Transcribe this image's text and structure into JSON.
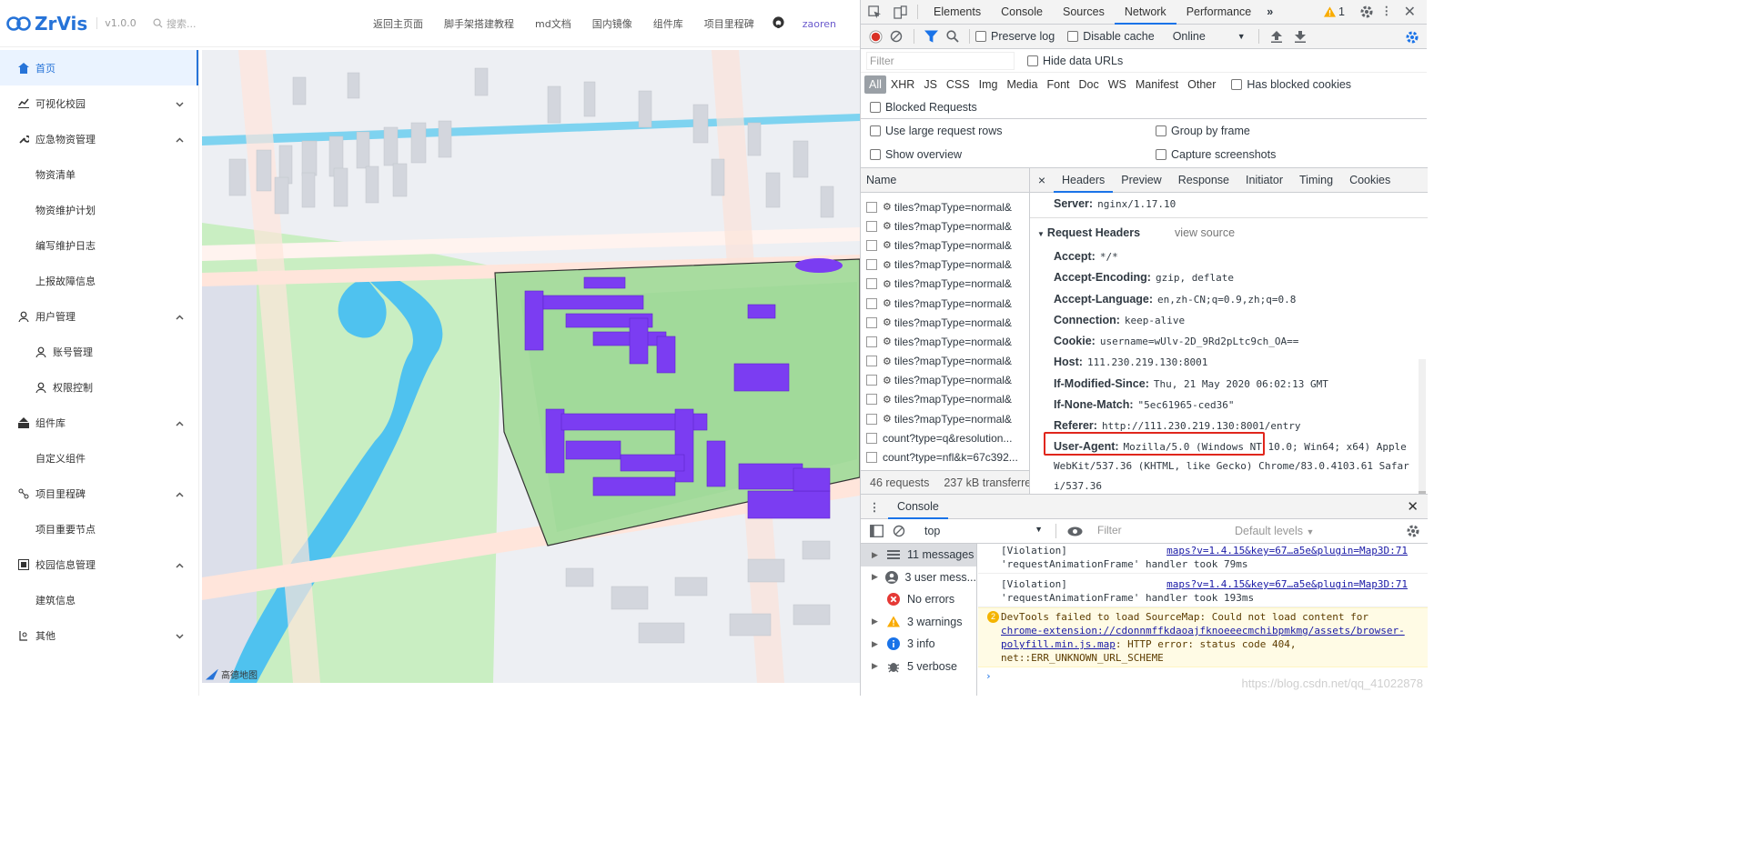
{
  "app": {
    "logo_text": "ZrVis",
    "version": "v1.0.0",
    "search_placeholder": "搜索...",
    "nav": [
      "返回主页面",
      "脚手架搭建教程",
      "md文档",
      "国内镜像",
      "组件库",
      "项目里程碑"
    ],
    "user": "zaoren",
    "menu": [
      {
        "label": "首页",
        "icon": "home-icon",
        "active": true
      },
      {
        "label": "可视化校园",
        "icon": "chart-icon",
        "chev": "down"
      },
      {
        "label": "应急物资管理",
        "icon": "wrench-icon",
        "chev": "up"
      },
      {
        "label": "物资清单",
        "sub": true
      },
      {
        "label": "物资维护计划",
        "sub": true
      },
      {
        "label": "编写维护日志",
        "sub": true
      },
      {
        "label": "上报故障信息",
        "sub": true
      },
      {
        "label": "用户管理",
        "icon": "user-icon",
        "chev": "up"
      },
      {
        "label": "账号管理",
        "sub": true,
        "icon": "user-icon"
      },
      {
        "label": "权限控制",
        "sub": true,
        "icon": "user-icon"
      },
      {
        "label": "组件库",
        "icon": "component-icon",
        "chev": "up"
      },
      {
        "label": "自定义组件",
        "sub": true
      },
      {
        "label": "项目里程碑",
        "icon": "milestone-icon",
        "chev": "up"
      },
      {
        "label": "项目重要节点",
        "sub": true
      },
      {
        "label": "校园信息管理",
        "icon": "info-icon",
        "chev": "up"
      },
      {
        "label": "建筑信息",
        "sub": true
      },
      {
        "label": "其他",
        "icon": "gear-icon",
        "chev": "down"
      }
    ],
    "map_credit": "高德地图"
  },
  "devtools": {
    "tabs": [
      "Elements",
      "Console",
      "Sources",
      "Network",
      "Performance"
    ],
    "selected_tab": "Network",
    "warning_count": "1",
    "toolbar": {
      "preserve_log": "Preserve log",
      "disable_cache": "Disable cache",
      "throttle": "Online"
    },
    "filter_placeholder": "Filter",
    "hide_data_urls": "Hide data URLs",
    "types": [
      "All",
      "XHR",
      "JS",
      "CSS",
      "Img",
      "Media",
      "Font",
      "Doc",
      "WS",
      "Manifest",
      "Other"
    ],
    "has_blocked_cookies": "Has blocked cookies",
    "blocked_requests": "Blocked Requests",
    "settings": {
      "large_rows": "Use large request rows",
      "group_by_frame": "Group by frame",
      "show_overview": "Show overview",
      "capture_screenshots": "Capture screenshots"
    },
    "name_header": "Name",
    "requests": [
      "tiles?mapType=normal&",
      "tiles?mapType=normal&",
      "tiles?mapType=normal&",
      "tiles?mapType=normal&",
      "tiles?mapType=normal&",
      "tiles?mapType=normal&",
      "tiles?mapType=normal&",
      "tiles?mapType=normal&",
      "tiles?mapType=normal&",
      "tiles?mapType=normal&",
      "tiles?mapType=normal&",
      "tiles?mapType=normal&",
      "count?type=q&resolution...",
      "count?type=nfl&k=67c392..."
    ],
    "status": {
      "requests": "46 requests",
      "transferred": "237 kB transferre"
    },
    "detail_tabs": [
      "Headers",
      "Preview",
      "Response",
      "Initiator",
      "Timing",
      "Cookies"
    ],
    "server": {
      "key": "Server:",
      "value": "nginx/1.17.10"
    },
    "request_headers_title": "Request Headers",
    "view_source": "view source",
    "headers": [
      {
        "key": "Accept:",
        "value": "*/*"
      },
      {
        "key": "Accept-Encoding:",
        "value": "gzip, deflate"
      },
      {
        "key": "Accept-Language:",
        "value": "en,zh-CN;q=0.9,zh;q=0.8"
      },
      {
        "key": "Connection:",
        "value": "keep-alive"
      },
      {
        "key": "Cookie:",
        "value": "username=wUlv-2D_9Rd2pLtc9ch_OA=="
      },
      {
        "key": "Host:",
        "value": "111.230.219.130:8001"
      },
      {
        "key": "If-Modified-Since:",
        "value": "Thu, 21 May 2020 06:02:13 GMT"
      },
      {
        "key": "If-None-Match:",
        "value": "\"5ec61965-ced36\""
      },
      {
        "key": "Referer:",
        "value": "http://111.230.219.130:8001/entry"
      }
    ],
    "user_agent": {
      "key": "User-Agent:",
      "value": "Mozilla/5.0 (Windows NT 10.0; Win64; x64) AppleWebKit/537.36 (KHTML, like Gecko) Chrome/83.0.4103.61 Safari/537.36"
    },
    "console": {
      "tab": "Console",
      "context": "top",
      "filter_placeholder": "Filter",
      "levels": "Default levels",
      "sidebar": [
        {
          "label": "11 messages",
          "icon": "list-icon"
        },
        {
          "label": "3 user mess...",
          "icon": "user-circle-icon"
        },
        {
          "label": "No errors",
          "icon": "error-icon"
        },
        {
          "label": "3 warnings",
          "icon": "warning-icon"
        },
        {
          "label": "3 info",
          "icon": "info-icon"
        },
        {
          "label": "5 verbose",
          "icon": "bug-icon"
        }
      ],
      "messages": [
        {
          "text": "[Violation] 'requestAnimationFrame' handler took 79ms",
          "link": "maps?v=1.4.15&key=67…a5e&plugin=Map3D:71"
        },
        {
          "text": "[Violation] 'requestAnimationFrame' handler took 193ms",
          "link": "maps?v=1.4.15&key=67…a5e&plugin=Map3D:71"
        }
      ],
      "warning": {
        "count": "2",
        "prefix": "DevTools failed to load SourceMap: Could not load content for ",
        "link": "chrome-extension://cdonnmffkdaoajfknoeeecmchibpmkmg/assets/browser-polyfill.min.js.map",
        "suffix": ": HTTP error: status code 404, net::ERR_UNKNOWN_URL_SCHEME"
      },
      "prompt": "›"
    },
    "watermark": "https://blog.csdn.net/qq_41022878"
  }
}
